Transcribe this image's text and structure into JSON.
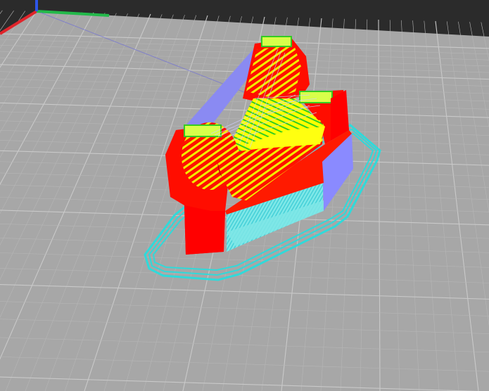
{
  "viewport": {
    "background_color": "#2b2b2b",
    "bed_color": "#a7a7a7",
    "grid_minor_color": "#b6b6b6",
    "grid_major_color": "#c9c9c9"
  },
  "axes": {
    "x_color": "#e0242b",
    "y_color": "#23b94a",
    "z_color": "#2d56e8"
  },
  "toolpath_colors": {
    "perimeter": "#ff0000",
    "solid_infill": "#ffff00",
    "internal_infill": "#22cc22",
    "support_side": "#8a8aff",
    "skirt": "#33e0e0",
    "travel": "#7070ff"
  }
}
